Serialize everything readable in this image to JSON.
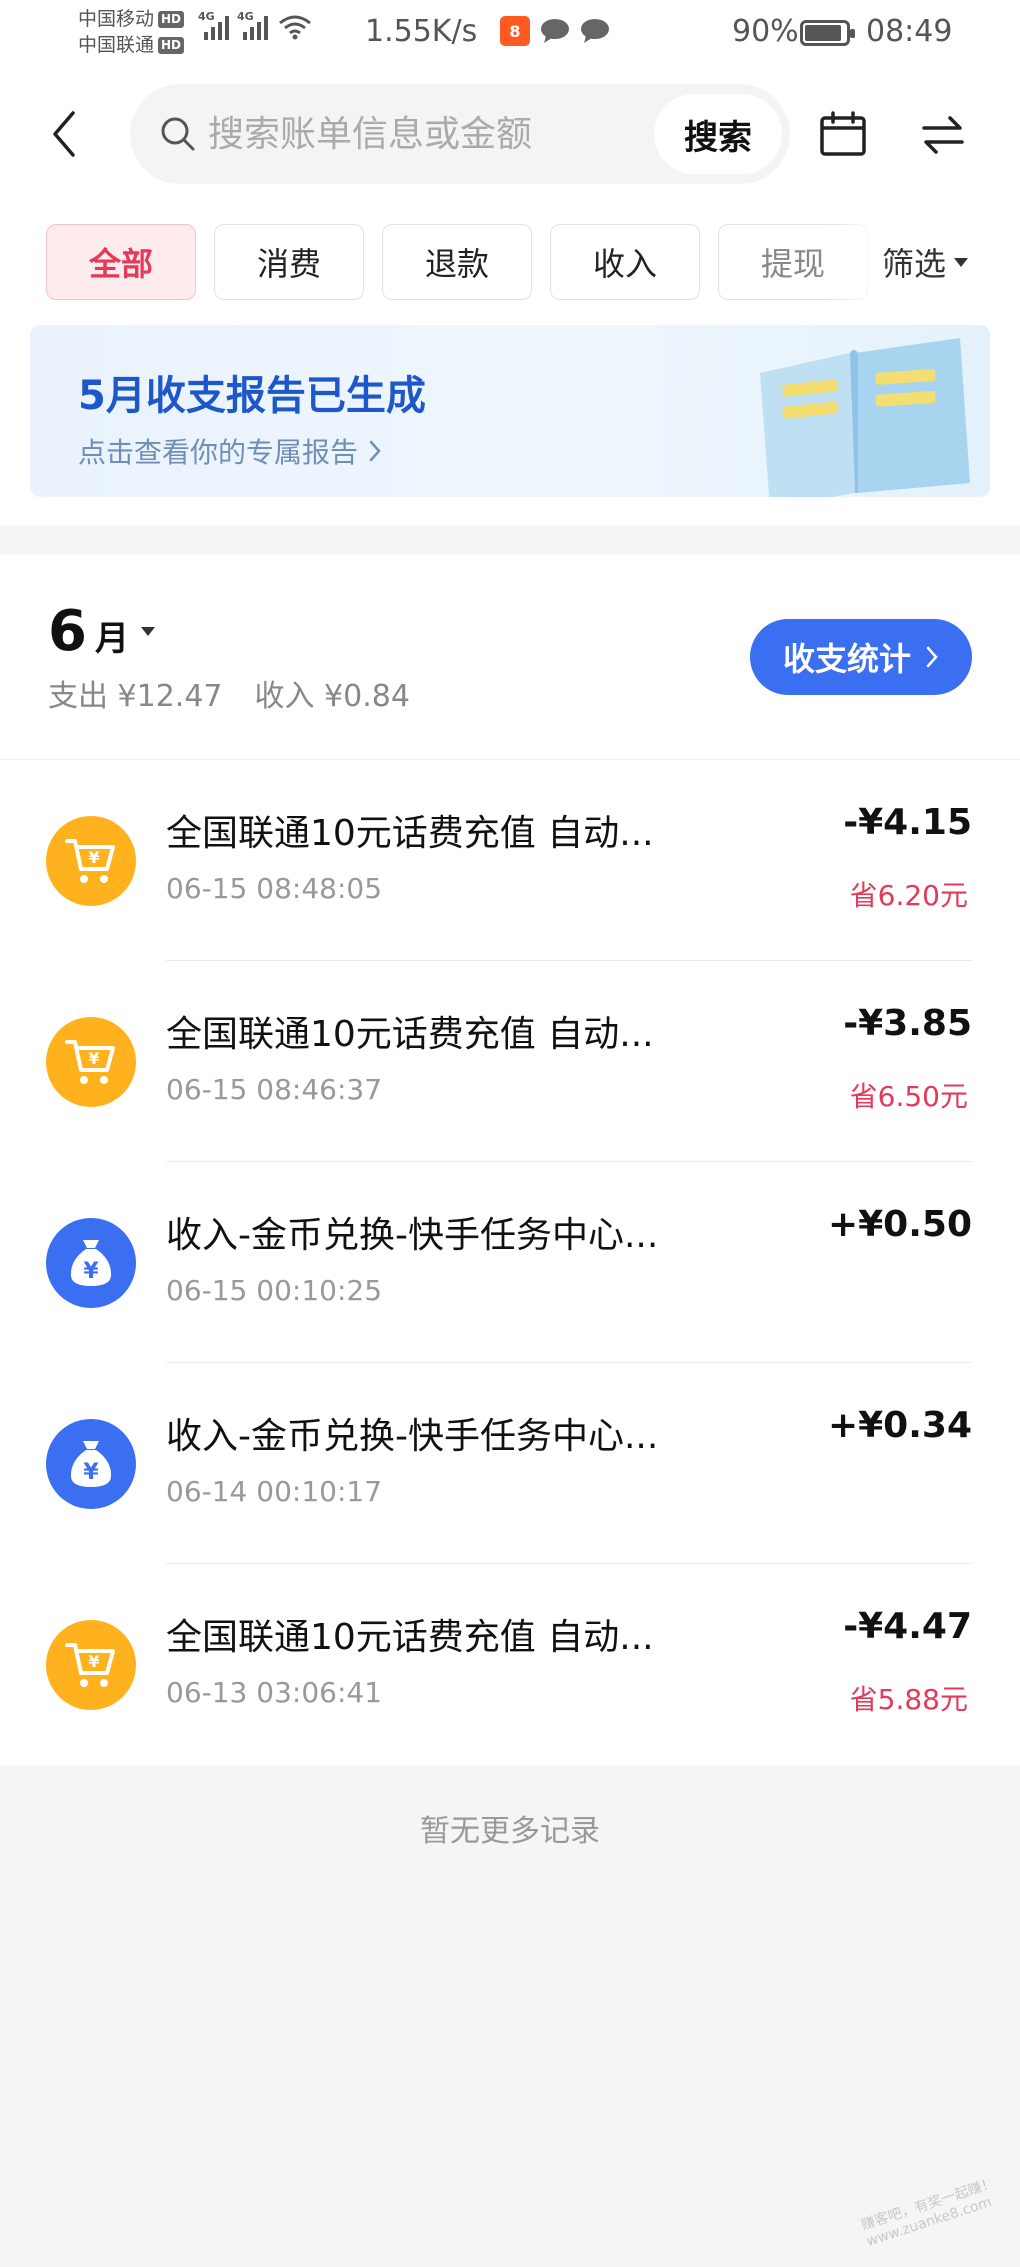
{
  "status_bar": {
    "carrier1": "中国移动",
    "carrier2": "中国联通",
    "hd": "HD",
    "net_type": "4G",
    "speed": "1.55K/s",
    "app_badge": "8",
    "battery": "90%",
    "battery_level": 0.9,
    "time": "08:49"
  },
  "header": {
    "search_placeholder": "搜索账单信息或金额",
    "search_button": "搜索"
  },
  "filters": {
    "chips": [
      "全部",
      "消费",
      "退款",
      "收入",
      "提现"
    ],
    "active_index": 0,
    "dropdown": "筛选"
  },
  "report": {
    "title": "5月收支报告已生成",
    "subtitle": "点击查看你的专属报告"
  },
  "month": {
    "number": "6",
    "unit": "月",
    "expense": "支出 ¥12.47",
    "income": "收入 ¥0.84",
    "stats_button": "收支统计"
  },
  "transactions": [
    {
      "icon": "cart-icon",
      "title": "全国联通10元话费充值 自动...",
      "time": "06-15 08:48:05",
      "amount": "-¥4.15",
      "saved": "省6.20元"
    },
    {
      "icon": "cart-icon",
      "title": "全国联通10元话费充值 自动...",
      "time": "06-15 08:46:37",
      "amount": "-¥3.85",
      "saved": "省6.50元"
    },
    {
      "icon": "money-bag-icon",
      "title": "收入-金币兑换-快手任务中心...",
      "time": "06-15 00:10:25",
      "amount": "+¥0.50",
      "saved": ""
    },
    {
      "icon": "money-bag-icon",
      "title": "收入-金币兑换-快手任务中心...",
      "time": "06-14 00:10:17",
      "amount": "+¥0.34",
      "saved": ""
    },
    {
      "icon": "cart-icon",
      "title": "全国联通10元话费充值 自动...",
      "time": "06-13 03:06:41",
      "amount": "-¥4.47",
      "saved": "省5.88元"
    }
  ],
  "footer": {
    "no_more": "暂无更多记录",
    "watermark": "赚客吧，有奖一起赚！ www.zuanke8.com"
  },
  "colors": {
    "accent_blue": "#3a6ff2",
    "active_red": "#e53a57",
    "shop_yellow": "#ffb21e",
    "report_title": "#1d57c9"
  }
}
